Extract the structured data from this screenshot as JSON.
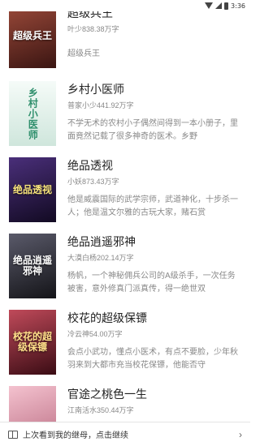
{
  "status_bar": {
    "time": "3:36"
  },
  "books": [
    {
      "title": "超级兵王",
      "author_size": "叶少838.38万字",
      "description": "超级兵王",
      "cover": {
        "text": "超级兵王",
        "bg": "#6b2a25",
        "icon": "cover-art"
      }
    },
    {
      "title": "乡村小医师",
      "author_size": "普家小少441.92万字",
      "description": "不学无术的农村小子偶然间得到一本小册子，里面竟然记载了很多神奇的医术。乡野",
      "cover": {
        "text": "乡村小医师",
        "bg": "#e8f3ee",
        "icon": "cover-art"
      }
    },
    {
      "title": "绝品透视",
      "author_size": "小妖873.43万字",
      "description": "他是威震国际的武学宗师，武道神化，十步杀一人；他是温文尔雅的古玩大家，赌石赏",
      "cover": {
        "text": "绝品透视",
        "bg": "#2e1b4d",
        "icon": "cover-art"
      }
    },
    {
      "title": "绝品逍遥邪神",
      "author_size": "大漠白杨202.14万字",
      "description": "杨帆，一个神秘佣兵公司的A级杀手，一次任务被害，意外修真门派真传，得一绝世双",
      "cover": {
        "text": "绝品逍遥邪神",
        "bg": "#3a3a45",
        "icon": "cover-art"
      }
    },
    {
      "title": "校花的超级保镖",
      "author_size": "冷云神54.00万字",
      "description": "会点小武功，懂点小医术，有点不要脸，少年秋羽来到大都市充当校花保镖，他能否守",
      "cover": {
        "text": "校花的超级保镖",
        "bg": "#7a2430",
        "icon": "cover-art"
      }
    },
    {
      "title": "官途之桃色一生",
      "author_size": "江南活水350.44万字",
      "description": "",
      "cover": {
        "text": "",
        "bg": "#e9a6b7",
        "icon": "cover-art"
      }
    }
  ],
  "footer": {
    "text": "上次看到我的继母，点击继续"
  },
  "colors": {
    "background": "#ffffff",
    "title": "#222222",
    "meta": "#888888"
  }
}
